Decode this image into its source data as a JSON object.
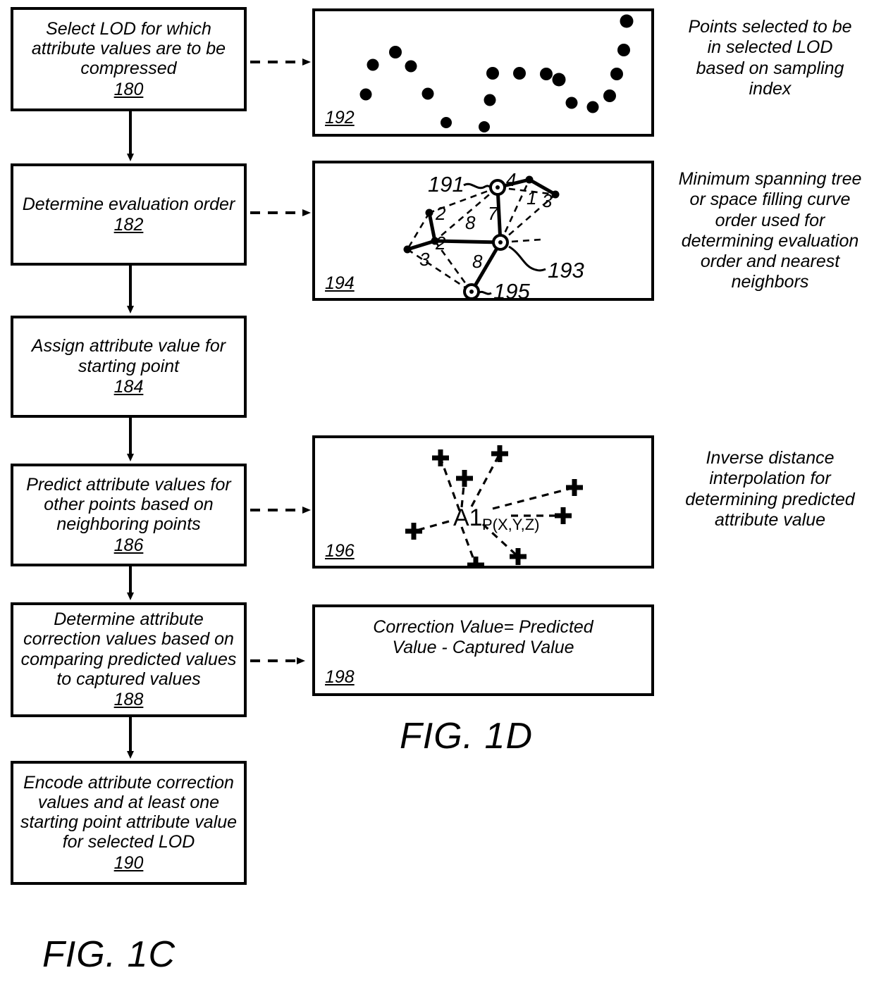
{
  "figure": {
    "fig_1c_label": "FIG. 1C",
    "fig_1d_label": "FIG. 1D"
  },
  "flowchart": {
    "steps": [
      {
        "text": "Select LOD for which\nattribute values are to be\ncompressed",
        "number": "180"
      },
      {
        "text": "Determine evaluation order",
        "number": "182"
      },
      {
        "text": "Assign attribute value for\nstarting point",
        "number": "184"
      },
      {
        "text": "Predict attribute values for\nother points based on\nneighboring points",
        "number": "186"
      },
      {
        "text": "Determine attribute\ncorrection values based on\ncomparing predicted values\nto captured values",
        "number": "188"
      },
      {
        "text": "Encode attribute correction\nvalues and at least one\nstarting point attribute value\nfor selected LOD",
        "number": "190"
      }
    ]
  },
  "panels": {
    "sampling": {
      "number": "192",
      "caption": "Points selected to be\nin selected LOD\nbased on sampling\nindex"
    },
    "spanning_tree": {
      "number": "194",
      "caption": "Minimum spanning tree\nor space filling curve\norder used for\ndetermining evaluation\norder and nearest\nneighbors",
      "callouts": [
        {
          "label": "191"
        },
        {
          "label": "193"
        },
        {
          "label": "195"
        }
      ],
      "edge_weights": [
        "4",
        "1",
        "3",
        "2",
        "2",
        "3",
        "7",
        "8",
        "8"
      ]
    },
    "interpolation": {
      "number": "196",
      "caption": "Inverse distance\ninterpolation for\ndetermining predicted\nattribute value",
      "center_label_main": "A1",
      "center_label_sub": "P(X,Y,Z)"
    },
    "correction": {
      "number": "198",
      "equation": "Correction Value= Predicted\nValue - Captured Value"
    }
  },
  "chart_data": {
    "type": "scatter",
    "title": "Points selected to be in selected LOD based on sampling index",
    "panel_id": "192",
    "xlabel": "",
    "ylabel": "",
    "grid": false,
    "legend": null,
    "xlim": [
      0,
      480
    ],
    "ylim": [
      0,
      180
    ],
    "points": [
      [
        72,
        118
      ],
      [
        82,
        76
      ],
      [
        114,
        58
      ],
      [
        136,
        78
      ],
      [
        160,
        117
      ],
      [
        186,
        158
      ],
      [
        240,
        164
      ],
      [
        248,
        126
      ],
      [
        252,
        88
      ],
      [
        290,
        88
      ],
      [
        328,
        89
      ],
      [
        346,
        97
      ],
      [
        364,
        130
      ],
      [
        394,
        136
      ],
      [
        418,
        120
      ],
      [
        428,
        89
      ],
      [
        438,
        55
      ],
      [
        442,
        14
      ]
    ]
  }
}
